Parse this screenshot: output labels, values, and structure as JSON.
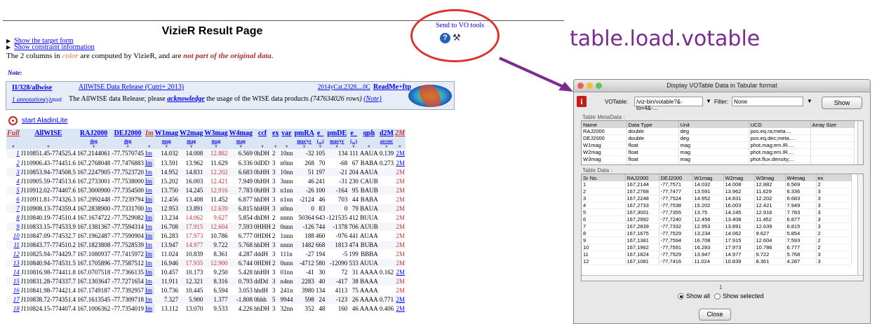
{
  "vizier": {
    "title": "VizieR Result Page",
    "send_vo": "Send to VO tools",
    "links": [
      "Show the target form",
      "Show constraint information"
    ],
    "intro_pre": "The 2 columns in ",
    "intro_color": "color",
    "intro_mid": " are computed by VizieR, and are ",
    "intro_not": "not part of the original data",
    "intro_end": ".",
    "note": "Note:",
    "catalog": {
      "id": "II/328/allwise",
      "name": "AllWISE Data Release (Cutri+ 2013)",
      "ref": "2014yCat.2328....0C",
      "readme": "ReadMe+ftp",
      "annot": "1 annotation(s)",
      "post": "post",
      "desc_pre": "The AllWISE data Release; please ",
      "desc_ack": "acknowledge",
      "desc_mid": " the usage of the WISE data products ",
      "desc_rows": "(747634026 rows)",
      "desc_note": "(Note)"
    },
    "aladin": "start AladinLite",
    "columns": [
      "Full",
      "AllWISE",
      "RAJ2000",
      "DEJ2000",
      "Im",
      "W1mag",
      "W2mag",
      "W3mag",
      "W4mag",
      "ccf",
      "ex",
      "var",
      "pmRA",
      "e_",
      "pmDE",
      "e_",
      "qph",
      "d2M",
      "2M"
    ],
    "units": [
      "",
      "",
      "deg",
      "deg",
      "",
      "mag",
      "mag",
      "mag",
      "mag",
      "",
      "",
      "",
      "mas/yr",
      "(...)",
      "mas/yr",
      "(...)",
      "",
      "arcsec",
      ""
    ],
    "rows": [
      [
        "1",
        "J110851.45-774525.4",
        "167.2144061",
        "-77.7570745",
        "Im",
        "14.032",
        "14.008",
        "12.882",
        "6.569",
        "0hDH",
        "2",
        "10nn",
        "-32",
        "105",
        "134",
        "111",
        "AAUA",
        "0.139",
        "2M"
      ],
      [
        "2",
        "J110906.43-774451.6",
        "167.2768048",
        "-77.7476883",
        "Im",
        "13.591",
        "13.962",
        "11.629",
        "6.336",
        "0dDD",
        "3",
        "n0nn",
        "268",
        "70",
        "-68",
        "67",
        "BABA",
        "0.273",
        "2M"
      ],
      [
        "3",
        "J110853.94-774508.5",
        "167.2247905",
        "-77.7523720",
        "Im",
        "14.952",
        "14.831",
        "12.202",
        "6.683",
        "0hHH",
        "3",
        "10nn",
        "51",
        "197",
        "-21",
        "204",
        "AAUA",
        "",
        "2M"
      ],
      [
        "4",
        "J110905.59-774513.6",
        "167.2733001",
        "-77.7538000",
        "Im",
        "15.202",
        "16.003",
        "12.421",
        "7.949",
        "0hHH",
        "3",
        "3nnn",
        "46",
        "241",
        "-31",
        "230",
        "CAUB",
        "",
        "2M"
      ],
      [
        "5",
        "J110912.02-774407.6",
        "167.3000900",
        "-77.7354500",
        "Im",
        "13.750",
        "14.245",
        "12.916",
        "7.783",
        "0hHH",
        "3",
        "n1nn",
        "-26",
        "100",
        "-164",
        "95",
        "BAUB",
        "",
        "2M"
      ],
      [
        "6",
        "J110911.81-774326.3",
        "167.2992448",
        "-77.7239794",
        "Im",
        "12.456",
        "13.408",
        "11.452",
        "6.877",
        "hhDH",
        "3",
        "n1nn",
        "-2124",
        "46",
        "703",
        "44",
        "BABA",
        "",
        "2M"
      ],
      [
        "7",
        "J110908.13-774359.4",
        "167.2838900",
        "-77.7331700",
        "Im",
        "12.953",
        "13.891",
        "12.639",
        "6.815",
        "hhHH",
        "3",
        "n0nn",
        "0",
        "83",
        "0",
        "79",
        "BAUA",
        "",
        "2M"
      ],
      [
        "8",
        "J110840.19-774510.4",
        "167.1674722",
        "-77.7529082",
        "Im",
        "13.234",
        "14.062",
        "9.627",
        "5.854",
        "dhDH",
        "2",
        "nnnn",
        "50364",
        "643",
        "-121535",
        "412",
        "BUUA",
        "",
        "2M"
      ],
      [
        "9",
        "J110833.15-774533.9",
        "167.1381367",
        "-77.7594314",
        "Im",
        "16.708",
        "17.915",
        "12.604",
        "7.593",
        "0HHH",
        "2",
        "0nnn",
        "-126",
        "744",
        "-1378",
        "706",
        "AUUB",
        "",
        "2M"
      ],
      [
        "10",
        "J110847.09-774532.7",
        "167.1962487",
        "-77.7590904",
        "Im",
        "16.283",
        "17.973",
        "10.786",
        "6.777",
        "0HDH",
        "2",
        "1nnn",
        "188",
        "460",
        "-976",
        "441",
        "AUAA",
        "",
        "2M"
      ],
      [
        "11",
        "J110843.77-774510.2",
        "167.1823808",
        "-77.7528539",
        "Im",
        "13.947",
        "14.977",
        "9.722",
        "5.768",
        "hhDH",
        "3",
        "nnnn",
        "1482",
        "668",
        "1813",
        "474",
        "BUBA",
        "",
        "2M"
      ],
      [
        "12",
        "J110825.94-774429.7",
        "167.1080937",
        "-77.7415972",
        "Im",
        "11.024",
        "10.839",
        "8.361",
        "4.287",
        "dddH",
        "3",
        "111n",
        "-27",
        "194",
        "-5",
        "199",
        "BBBA",
        "",
        "2M"
      ],
      [
        "13",
        "J110840.94-774531.5",
        "167.1705896",
        "-77.7587512",
        "Im",
        "16.946",
        "17.935",
        "12.900",
        "6.744",
        "0HDH",
        "2",
        "0nnn",
        "-4712",
        "580",
        "-12090",
        "533",
        "AUUA",
        "",
        "2M"
      ],
      [
        "14",
        "J110816.98-774411.8",
        "167.0707518",
        "-77.7366135",
        "Im",
        "10.457",
        "10.173",
        "9.250",
        "5.428",
        "hhHH",
        "3",
        "01nn",
        "-41",
        "30",
        "72",
        "31",
        "AAAA",
        "0.162",
        "2M"
      ],
      [
        "15",
        "J110831.28-774337.7",
        "167.1303647",
        "-77.7271654",
        "Im",
        "11.911",
        "12.321",
        "8.316",
        "0.793",
        "ddDd",
        "3",
        "n4nn",
        "2283",
        "40",
        "-417",
        "38",
        "BAAA",
        "",
        "2M"
      ],
      [
        "16",
        "J110841.98-774421.4",
        "167.1749187",
        "-77.7392957",
        "Im",
        "10.736",
        "10.445",
        "6.594",
        "3.053",
        "hhdH",
        "3",
        "241n",
        "3980",
        "134",
        "4113",
        "75",
        "AAAA",
        "",
        "2M"
      ],
      [
        "17",
        "J110838.72-774351.4",
        "167.1613545",
        "-77.7309718",
        "Im",
        "7.327",
        "5.900",
        "1.377",
        "-1.808",
        "0hhh",
        "5",
        "9944",
        "598",
        "24",
        "-123",
        "26",
        "AAAA",
        "0.771",
        "2M"
      ],
      [
        "18",
        "J110824.15-774407.4",
        "167.1006362",
        "-77.7354019",
        "Im",
        "13.112",
        "13.070",
        "9.533",
        "4.226",
        "hhDH",
        "3",
        "32nn",
        "352",
        "48",
        "160",
        "46",
        "AAAA",
        "0.406",
        "2M"
      ]
    ],
    "red_cells": {
      "1": [
        7
      ],
      "2": [],
      "3": [
        7
      ],
      "4": [
        7
      ],
      "5": [
        7
      ],
      "6": [],
      "7": [
        7
      ],
      "8": [
        6,
        7
      ],
      "9": [
        6,
        7
      ],
      "10": [
        6
      ],
      "11": [
        6
      ],
      "12": [],
      "13": [
        6,
        7
      ],
      "14": [],
      "15": [],
      "16": [],
      "17": [],
      "18": []
    }
  },
  "annotation": {
    "title": "table.load.votable",
    "arrow_color": "#7b2b8f",
    "circle_color": "#e0322d"
  },
  "window": {
    "title": "Display VOTable Data in Tabular format",
    "votable_label": "VOTable:",
    "votable_value": "/viz-bin/votable?&-to=4&-...",
    "filter_label": "Filter:",
    "filter_value": "None",
    "show_button": "Show",
    "meta_label": "Table MetaData :",
    "meta_headers": [
      "Name",
      "Data Type",
      "Unit",
      "UCD",
      "Array Size"
    ],
    "meta_rows": [
      [
        "RAJ2000",
        "double",
        "deg",
        "pos.eq.ra;meta....",
        ""
      ],
      [
        "DEJ2000",
        "double",
        "deg",
        "pos.eq.dec;meta....",
        ""
      ],
      [
        "W1mag",
        "float",
        "mag",
        "phot.mag;em.IR....",
        ""
      ],
      [
        "W2mag",
        "float",
        "mag",
        "phot.mag;em.IR....",
        ""
      ],
      [
        "W3mag",
        "float",
        "mag",
        "phot.flux.density;...",
        ""
      ],
      [
        "W4mag",
        "float",
        "mag",
        "phot.flux.density;...",
        ""
      ]
    ],
    "data_label": "Table Data :",
    "data_headers": [
      "Sr No.",
      "RAJ2000",
      "DEJ2000",
      "W1mag",
      "W2mag",
      "W3mag",
      "W4mag",
      "ex"
    ],
    "data_rows": [
      [
        "1",
        "167,2144",
        "-77,7571",
        "14.032",
        "14.008",
        "12.882",
        "6.569",
        "2"
      ],
      [
        "2",
        "167,2768",
        "-77,7477",
        "13.591",
        "13.962",
        "11.629",
        "6.336",
        "3"
      ],
      [
        "3",
        "167,2248",
        "-77,7524",
        "14.952",
        "14.831",
        "12.202",
        "6.683",
        "3"
      ],
      [
        "4",
        "167,2733",
        "-77,7538",
        "15.202",
        "16.003",
        "12.421",
        "7.949",
        "3"
      ],
      [
        "5",
        "167,3001",
        "-77,7355",
        "13.75",
        "14.245",
        "12.916",
        "7.783",
        "3"
      ],
      [
        "6",
        "167,2992",
        "-77,7240",
        "12.456",
        "13.408",
        "11.452",
        "6.877",
        "3"
      ],
      [
        "7",
        "167,2839",
        "-77,7332",
        "12.953",
        "13.891",
        "12.639",
        "6.815",
        "3"
      ],
      [
        "8",
        "167,1675",
        "-77,7529",
        "13.234",
        "14.062",
        "9.627",
        "5.854",
        "2"
      ],
      [
        "9",
        "167,1381",
        "-77,7594",
        "16.708",
        "17.915",
        "12.604",
        "7.593",
        "2"
      ],
      [
        "10",
        "167,1962",
        "-77,7591",
        "16.283",
        "17.973",
        "10.786",
        "6.777",
        "2"
      ],
      [
        "11",
        "167,1824",
        "-77,7529",
        "13.947",
        "14.977",
        "9.722",
        "5.768",
        "3"
      ],
      [
        "12",
        "167,1081",
        "-77,7416",
        "11.024",
        "10.839",
        "8.361",
        "4.287",
        "3"
      ]
    ],
    "count": "1",
    "radio_all": "Show all",
    "radio_selected": "Show selected",
    "close_button": "Close"
  }
}
